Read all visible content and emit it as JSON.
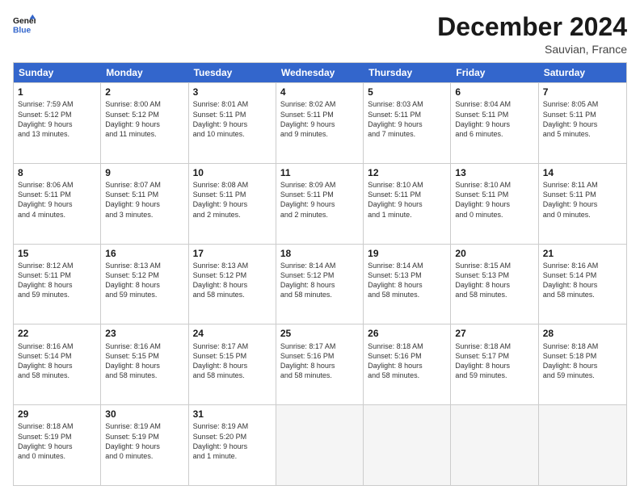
{
  "header": {
    "logo_line1": "General",
    "logo_line2": "Blue",
    "month": "December 2024",
    "location": "Sauvian, France"
  },
  "days_of_week": [
    "Sunday",
    "Monday",
    "Tuesday",
    "Wednesday",
    "Thursday",
    "Friday",
    "Saturday"
  ],
  "weeks": [
    [
      {
        "day": "1",
        "lines": [
          "Sunrise: 7:59 AM",
          "Sunset: 5:12 PM",
          "Daylight: 9 hours",
          "and 13 minutes."
        ]
      },
      {
        "day": "2",
        "lines": [
          "Sunrise: 8:00 AM",
          "Sunset: 5:12 PM",
          "Daylight: 9 hours",
          "and 11 minutes."
        ]
      },
      {
        "day": "3",
        "lines": [
          "Sunrise: 8:01 AM",
          "Sunset: 5:11 PM",
          "Daylight: 9 hours",
          "and 10 minutes."
        ]
      },
      {
        "day": "4",
        "lines": [
          "Sunrise: 8:02 AM",
          "Sunset: 5:11 PM",
          "Daylight: 9 hours",
          "and 9 minutes."
        ]
      },
      {
        "day": "5",
        "lines": [
          "Sunrise: 8:03 AM",
          "Sunset: 5:11 PM",
          "Daylight: 9 hours",
          "and 7 minutes."
        ]
      },
      {
        "day": "6",
        "lines": [
          "Sunrise: 8:04 AM",
          "Sunset: 5:11 PM",
          "Daylight: 9 hours",
          "and 6 minutes."
        ]
      },
      {
        "day": "7",
        "lines": [
          "Sunrise: 8:05 AM",
          "Sunset: 5:11 PM",
          "Daylight: 9 hours",
          "and 5 minutes."
        ]
      }
    ],
    [
      {
        "day": "8",
        "lines": [
          "Sunrise: 8:06 AM",
          "Sunset: 5:11 PM",
          "Daylight: 9 hours",
          "and 4 minutes."
        ]
      },
      {
        "day": "9",
        "lines": [
          "Sunrise: 8:07 AM",
          "Sunset: 5:11 PM",
          "Daylight: 9 hours",
          "and 3 minutes."
        ]
      },
      {
        "day": "10",
        "lines": [
          "Sunrise: 8:08 AM",
          "Sunset: 5:11 PM",
          "Daylight: 9 hours",
          "and 2 minutes."
        ]
      },
      {
        "day": "11",
        "lines": [
          "Sunrise: 8:09 AM",
          "Sunset: 5:11 PM",
          "Daylight: 9 hours",
          "and 2 minutes."
        ]
      },
      {
        "day": "12",
        "lines": [
          "Sunrise: 8:10 AM",
          "Sunset: 5:11 PM",
          "Daylight: 9 hours",
          "and 1 minute."
        ]
      },
      {
        "day": "13",
        "lines": [
          "Sunrise: 8:10 AM",
          "Sunset: 5:11 PM",
          "Daylight: 9 hours",
          "and 0 minutes."
        ]
      },
      {
        "day": "14",
        "lines": [
          "Sunrise: 8:11 AM",
          "Sunset: 5:11 PM",
          "Daylight: 9 hours",
          "and 0 minutes."
        ]
      }
    ],
    [
      {
        "day": "15",
        "lines": [
          "Sunrise: 8:12 AM",
          "Sunset: 5:11 PM",
          "Daylight: 8 hours",
          "and 59 minutes."
        ]
      },
      {
        "day": "16",
        "lines": [
          "Sunrise: 8:13 AM",
          "Sunset: 5:12 PM",
          "Daylight: 8 hours",
          "and 59 minutes."
        ]
      },
      {
        "day": "17",
        "lines": [
          "Sunrise: 8:13 AM",
          "Sunset: 5:12 PM",
          "Daylight: 8 hours",
          "and 58 minutes."
        ]
      },
      {
        "day": "18",
        "lines": [
          "Sunrise: 8:14 AM",
          "Sunset: 5:12 PM",
          "Daylight: 8 hours",
          "and 58 minutes."
        ]
      },
      {
        "day": "19",
        "lines": [
          "Sunrise: 8:14 AM",
          "Sunset: 5:13 PM",
          "Daylight: 8 hours",
          "and 58 minutes."
        ]
      },
      {
        "day": "20",
        "lines": [
          "Sunrise: 8:15 AM",
          "Sunset: 5:13 PM",
          "Daylight: 8 hours",
          "and 58 minutes."
        ]
      },
      {
        "day": "21",
        "lines": [
          "Sunrise: 8:16 AM",
          "Sunset: 5:14 PM",
          "Daylight: 8 hours",
          "and 58 minutes."
        ]
      }
    ],
    [
      {
        "day": "22",
        "lines": [
          "Sunrise: 8:16 AM",
          "Sunset: 5:14 PM",
          "Daylight: 8 hours",
          "and 58 minutes."
        ]
      },
      {
        "day": "23",
        "lines": [
          "Sunrise: 8:16 AM",
          "Sunset: 5:15 PM",
          "Daylight: 8 hours",
          "and 58 minutes."
        ]
      },
      {
        "day": "24",
        "lines": [
          "Sunrise: 8:17 AM",
          "Sunset: 5:15 PM",
          "Daylight: 8 hours",
          "and 58 minutes."
        ]
      },
      {
        "day": "25",
        "lines": [
          "Sunrise: 8:17 AM",
          "Sunset: 5:16 PM",
          "Daylight: 8 hours",
          "and 58 minutes."
        ]
      },
      {
        "day": "26",
        "lines": [
          "Sunrise: 8:18 AM",
          "Sunset: 5:16 PM",
          "Daylight: 8 hours",
          "and 58 minutes."
        ]
      },
      {
        "day": "27",
        "lines": [
          "Sunrise: 8:18 AM",
          "Sunset: 5:17 PM",
          "Daylight: 8 hours",
          "and 59 minutes."
        ]
      },
      {
        "day": "28",
        "lines": [
          "Sunrise: 8:18 AM",
          "Sunset: 5:18 PM",
          "Daylight: 8 hours",
          "and 59 minutes."
        ]
      }
    ],
    [
      {
        "day": "29",
        "lines": [
          "Sunrise: 8:18 AM",
          "Sunset: 5:19 PM",
          "Daylight: 9 hours",
          "and 0 minutes."
        ]
      },
      {
        "day": "30",
        "lines": [
          "Sunrise: 8:19 AM",
          "Sunset: 5:19 PM",
          "Daylight: 9 hours",
          "and 0 minutes."
        ]
      },
      {
        "day": "31",
        "lines": [
          "Sunrise: 8:19 AM",
          "Sunset: 5:20 PM",
          "Daylight: 9 hours",
          "and 1 minute."
        ]
      },
      {
        "day": "",
        "lines": []
      },
      {
        "day": "",
        "lines": []
      },
      {
        "day": "",
        "lines": []
      },
      {
        "day": "",
        "lines": []
      }
    ]
  ]
}
